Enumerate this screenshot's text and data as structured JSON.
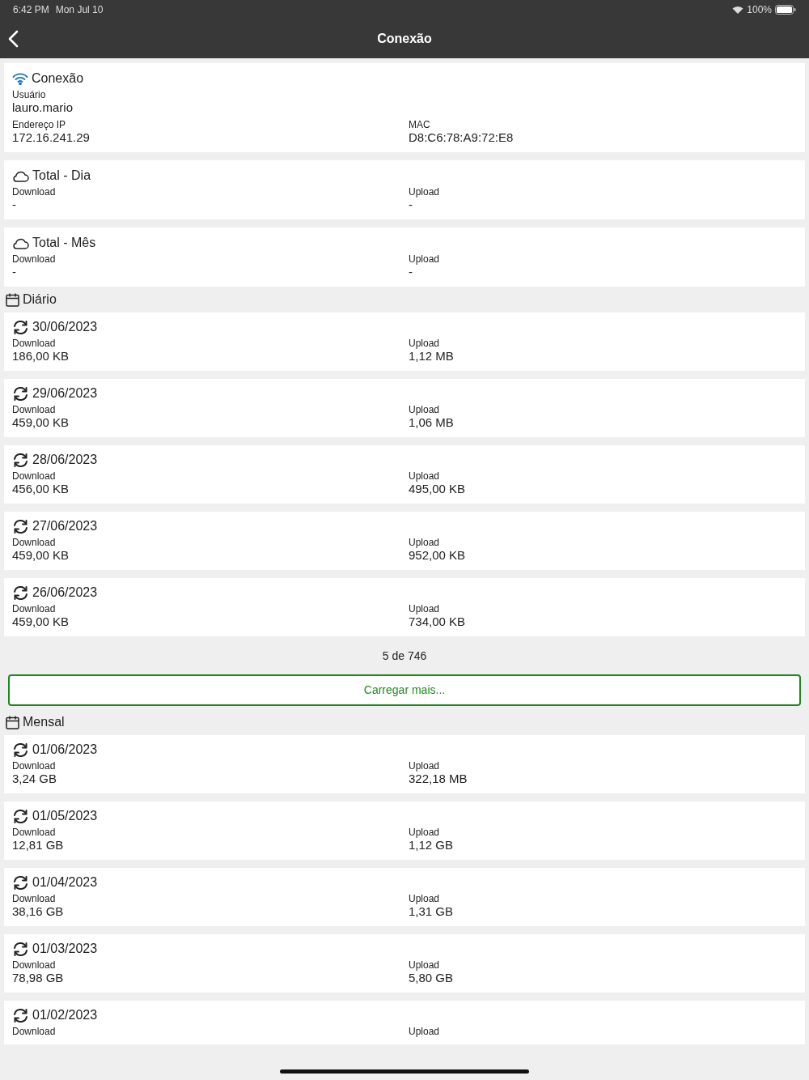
{
  "status_bar": {
    "time": "6:42 PM",
    "date": "Mon Jul 10",
    "battery": "100%"
  },
  "header": {
    "title": "Conexão"
  },
  "connection": {
    "title": "Conexão",
    "user_label": "Usuário",
    "user": "lauro.mario",
    "ip_label": "Endereço IP",
    "ip": "172.16.241.29",
    "mac_label": "MAC",
    "mac": "D8:C6:78:A9:72:E8"
  },
  "totals": [
    {
      "title": "Total - Dia",
      "download_label": "Download",
      "download": "-",
      "upload_label": "Upload",
      "upload": "-"
    },
    {
      "title": "Total - Mês",
      "download_label": "Download",
      "download": "-",
      "upload_label": "Upload",
      "upload": "-"
    }
  ],
  "sections": [
    {
      "title": "Diário",
      "entries": [
        {
          "date": "30/06/2023",
          "download_label": "Download",
          "download": "186,00 KB",
          "upload_label": "Upload",
          "upload": "1,12 MB"
        },
        {
          "date": "29/06/2023",
          "download_label": "Download",
          "download": "459,00 KB",
          "upload_label": "Upload",
          "upload": "1,06 MB"
        },
        {
          "date": "28/06/2023",
          "download_label": "Download",
          "download": "456,00 KB",
          "upload_label": "Upload",
          "upload": "495,00 KB"
        },
        {
          "date": "27/06/2023",
          "download_label": "Download",
          "download": "459,00 KB",
          "upload_label": "Upload",
          "upload": "952,00 KB"
        },
        {
          "date": "26/06/2023",
          "download_label": "Download",
          "download": "459,00 KB",
          "upload_label": "Upload",
          "upload": "734,00 KB"
        }
      ],
      "count": "5 de 746",
      "load_more": "Carregar mais..."
    },
    {
      "title": "Mensal",
      "entries": [
        {
          "date": "01/06/2023",
          "download_label": "Download",
          "download": "3,24 GB",
          "upload_label": "Upload",
          "upload": "322,18 MB"
        },
        {
          "date": "01/05/2023",
          "download_label": "Download",
          "download": "12,81 GB",
          "upload_label": "Upload",
          "upload": "1,12 GB"
        },
        {
          "date": "01/04/2023",
          "download_label": "Download",
          "download": "38,16 GB",
          "upload_label": "Upload",
          "upload": "1,31 GB"
        },
        {
          "date": "01/03/2023",
          "download_label": "Download",
          "download": "78,98 GB",
          "upload_label": "Upload",
          "upload": "5,80 GB"
        },
        {
          "date": "01/02/2023",
          "download_label": "Download",
          "upload_label": "Upload"
        }
      ]
    }
  ]
}
